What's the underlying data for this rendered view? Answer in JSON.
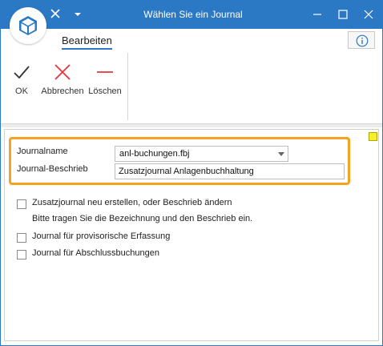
{
  "window": {
    "title": "Wählen Sie ein Journal"
  },
  "ribbon": {
    "tab_label": "Bearbeiten",
    "buttons": {
      "ok": "OK",
      "cancel": "Abbrechen",
      "delete": "Löschen"
    }
  },
  "form": {
    "journal_name_label": "Journalname",
    "journal_name_value": "anl-buchungen.fbj",
    "journal_desc_label": "Journal-Beschrieb",
    "journal_desc_value": "Zusatzjournal Anlagenbuchhaltung"
  },
  "options": {
    "new_or_edit_label": "Zusatzjournal neu erstellen, oder Beschrieb ändern",
    "new_or_edit_checked": false,
    "hint": "Bitte tragen Sie die Bezeichnung und den Beschrieb ein.",
    "provisional_label": "Journal für provisorische Erfassung",
    "provisional_checked": false,
    "closing_label": "Journal für Abschlussbuchungen",
    "closing_checked": false
  },
  "colors": {
    "titlebar": "#2b78c4",
    "highlight": "#f5a21e",
    "ok_icon": "#333333",
    "cancel_icon": "#e0363c",
    "delete_icon": "#e0363c",
    "status_indicator": "#f4ef2a"
  },
  "icons": {
    "app": "cube-icon",
    "quick_access_close": "close-icon",
    "quick_access_menu": "chevron-down-icon",
    "info": "info-icon"
  }
}
